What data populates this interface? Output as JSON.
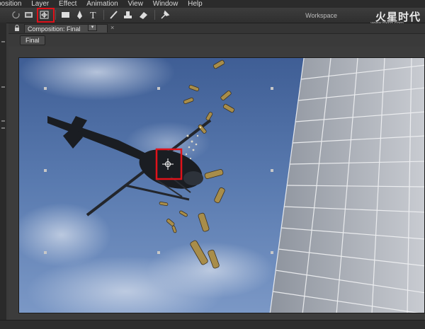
{
  "menu": {
    "items": [
      "position",
      "Layer",
      "Effect",
      "Animation",
      "View",
      "Window",
      "Help"
    ]
  },
  "toolbar": {
    "workspace_label": "Workspace",
    "logo_text": "火星时代",
    "logo_url": "www.hxsd.com",
    "tools": [
      "rotate-icon",
      "camera-orbit-icon",
      "pan-behind-anchor-icon",
      "rectangle-mask-icon",
      "pen-icon",
      "type-icon",
      "brush-icon",
      "clone-stamp-icon",
      "eraser-icon",
      "puppet-pin-icon"
    ],
    "highlighted_tool": "pan-behind-anchor-icon"
  },
  "panel": {
    "tab_label": "Composition: Final",
    "tab_dropdown": "▾",
    "tab_close": "×",
    "breadcrumb": "Final"
  },
  "colors": {
    "highlight": "#e0121a",
    "sky": "#4d6ea3"
  }
}
